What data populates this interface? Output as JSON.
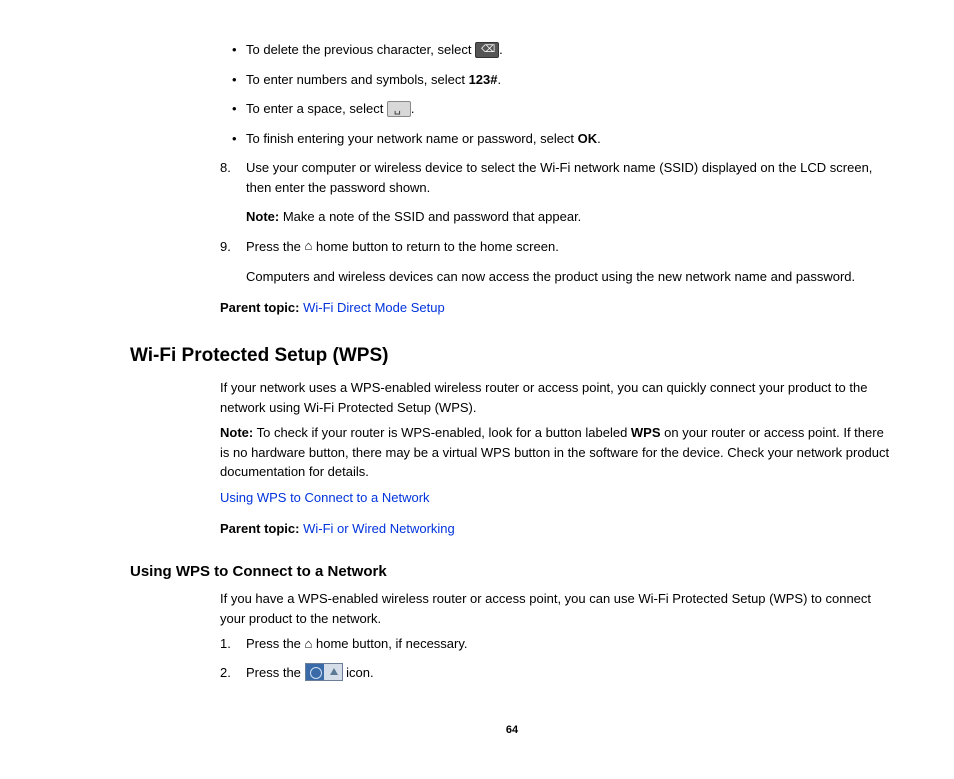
{
  "bullets": {
    "b1_pre": "To delete the previous character, select ",
    "b1_post": ".",
    "b2_pre": "To enter numbers and symbols, select ",
    "b2_bold": "123#",
    "b2_post": ".",
    "b3_pre": "To enter a space, select ",
    "b3_post": ".",
    "b4_pre": "To finish entering your network name or password, select ",
    "b4_bold": "OK",
    "b4_post": "."
  },
  "step8": {
    "num": "8.",
    "text": "Use your computer or wireless device to select the Wi-Fi network name (SSID) displayed on the LCD screen, then enter the password shown.",
    "note_label": "Note:",
    "note_text": " Make a note of the SSID and password that appear."
  },
  "step9": {
    "num": "9.",
    "pre": "Press the ",
    "post": " home button to return to the home screen.",
    "sub": "Computers and wireless devices can now access the product using the new network name and password."
  },
  "parent1": {
    "label": "Parent topic: ",
    "link": "Wi-Fi Direct Mode Setup"
  },
  "wps": {
    "heading": "Wi-Fi Protected Setup (WPS)",
    "intro": "If your network uses a WPS-enabled wireless router or access point, you can quickly connect your product to the network using Wi-Fi Protected Setup (WPS).",
    "note_label": "Note:",
    "note_pre": " To check if your router is WPS-enabled, look for a button labeled ",
    "note_bold": "WPS",
    "note_post": " on your router or access point. If there is no hardware button, there may be a virtual WPS button in the software for the device. Check your network product documentation for details.",
    "link1": "Using WPS to Connect to a Network",
    "parent_label": "Parent topic: ",
    "parent_link": "Wi-Fi or Wired Networking"
  },
  "using_wps": {
    "heading": "Using WPS to Connect to a Network",
    "intro": "If you have a WPS-enabled wireless router or access point, you can use Wi-Fi Protected Setup (WPS) to connect your product to the network.",
    "s1_num": "1.",
    "s1_pre": "Press the ",
    "s1_post": " home button, if necessary.",
    "s2_num": "2.",
    "s2_pre": "Press the ",
    "s2_post": " icon."
  },
  "page_number": "64"
}
